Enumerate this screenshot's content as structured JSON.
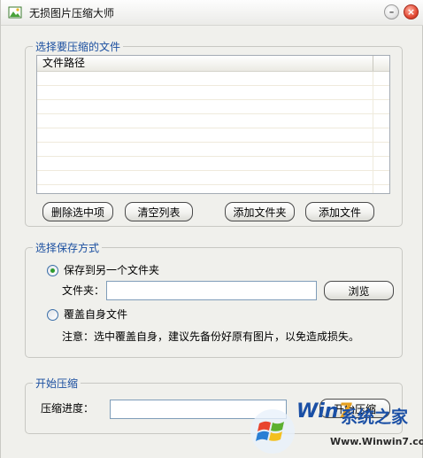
{
  "window": {
    "title": "无损图片压缩大师"
  },
  "file_group": {
    "legend": "选择要压缩的文件",
    "list": {
      "column_header": "文件路径",
      "rows": []
    },
    "buttons": {
      "delete_selected": "删除选中项",
      "clear_list": "清空列表",
      "add_folder": "添加文件夹",
      "add_file": "添加文件"
    }
  },
  "save_group": {
    "legend": "选择保存方式",
    "option_other_folder": {
      "label": "保存到另一个文件夹",
      "selected": true
    },
    "folder_label": "文件夹：",
    "folder_value": "",
    "browse_button": "浏览",
    "option_overwrite": {
      "label": "覆盖自身文件",
      "selected": false
    },
    "note": "注意：选中覆盖自身，建议先备份好原有图片，以免造成损失。"
  },
  "compress_group": {
    "legend": "开始压缩",
    "progress_label": "压缩进度：",
    "progress_value": "",
    "start_button": "开始压缩"
  },
  "watermark": {
    "brand_prefix": "Win",
    "brand_seven": "7",
    "brand_cn": "系统之家",
    "url": "Www.Winwin7.com"
  },
  "colors": {
    "legend_text": "#1b4fa0",
    "radio_dot": "#2d9b2d",
    "close_button": "#e34a35"
  }
}
